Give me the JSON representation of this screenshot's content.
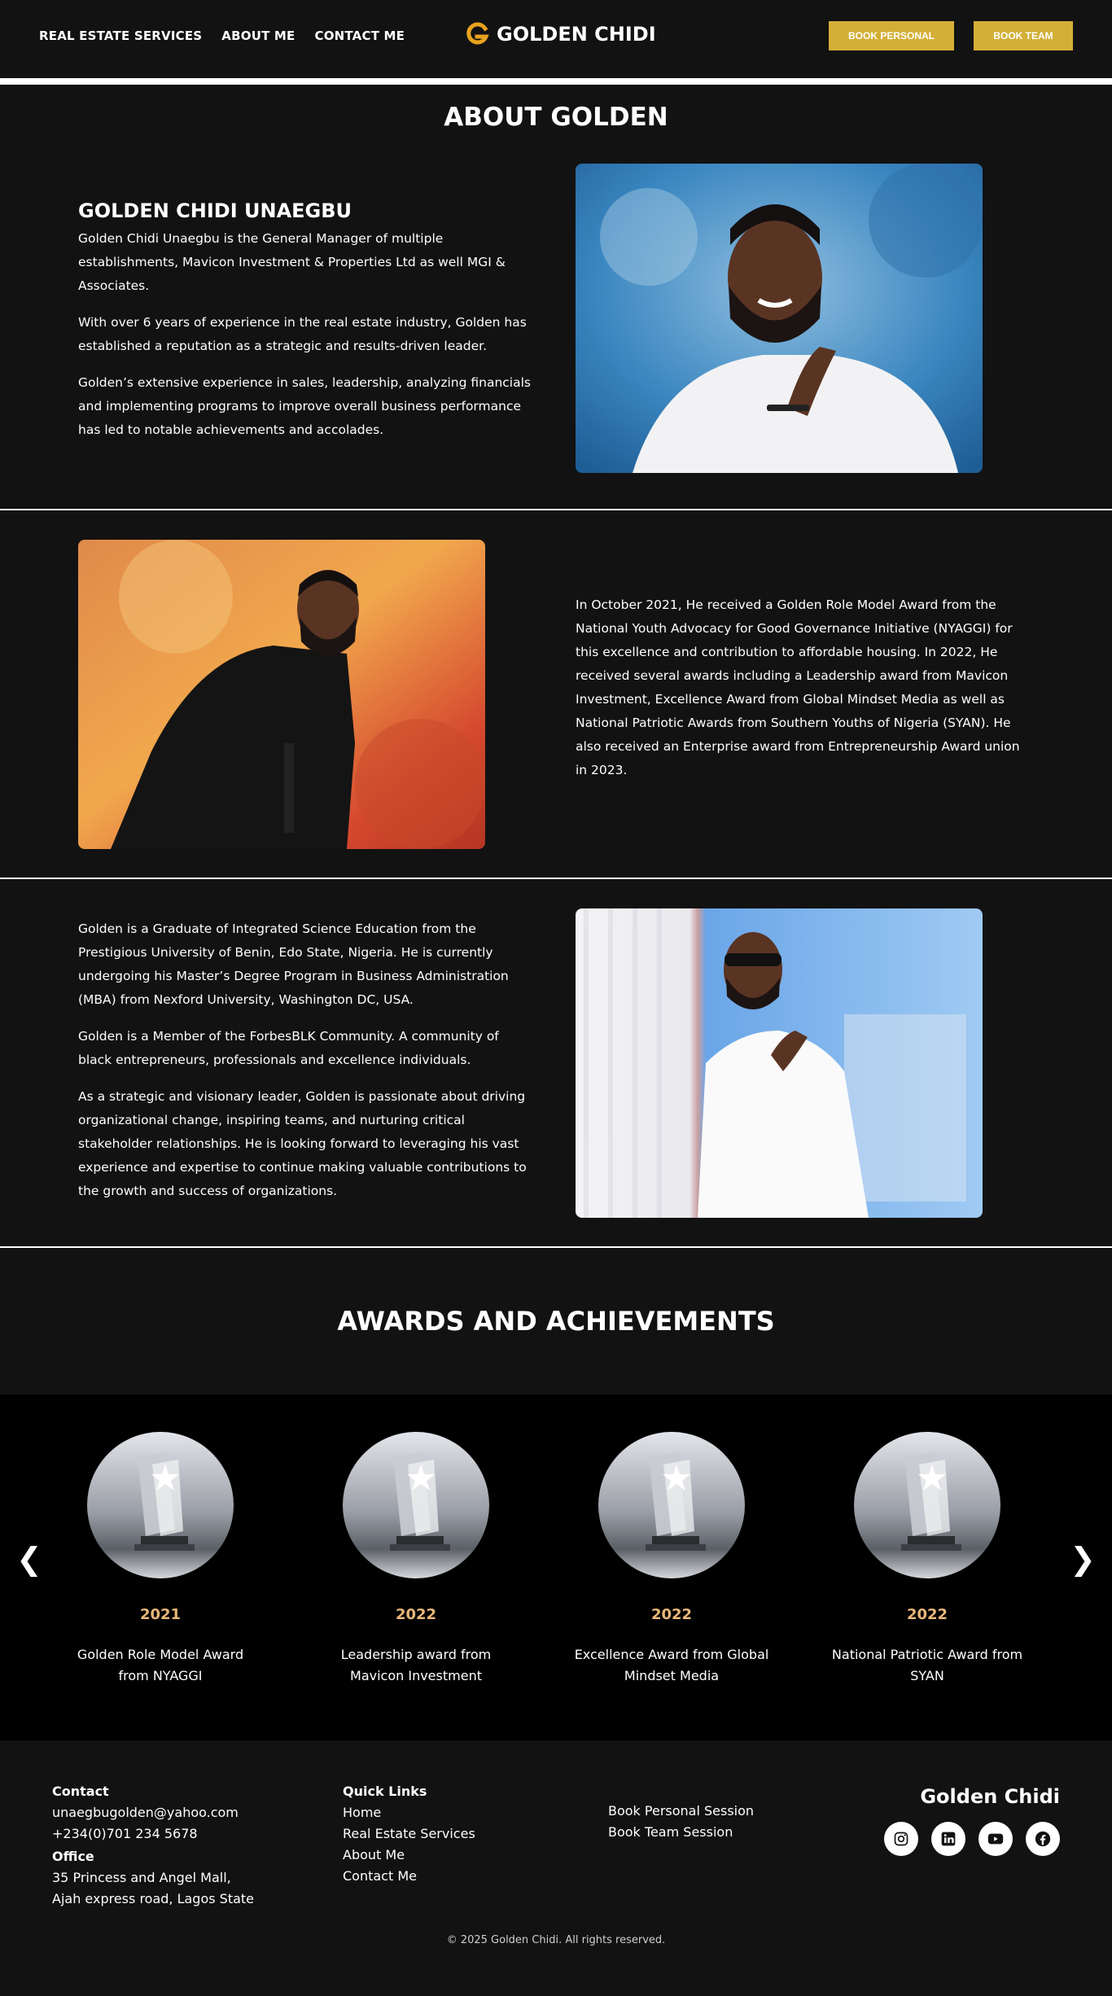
{
  "nav": {
    "links": [
      "REAL ESTATE SERVICES",
      "ABOUT ME",
      "CONTACT ME"
    ],
    "logo_text": "GOLDEN CHIDI",
    "book_personal": "BOOK PERSONAL",
    "book_team": "BOOK TEAM"
  },
  "about": {
    "title": "ABOUT GOLDEN",
    "name": "GOLDEN CHIDI UNAEGBU",
    "block1": [
      "Golden Chidi Unaegbu is the General Manager of multiple establishments, Mavicon Investment & Properties Ltd as well MGI & Associates.",
      "With over 6 years of experience in the real estate industry, Golden has established a reputation as a strategic and results-driven leader.",
      "Golden’s extensive experience in sales, leadership, analyzing financials and implementing programs to improve overall business performance has led to notable achievements and accolades."
    ],
    "block2": "In October 2021, He received a Golden Role Model Award from the National Youth Advocacy for Good Governance Initiative (NYAGGI) for this excellence and contribution to affordable housing. In 2022, He received several awards including a Leadership award from Mavicon Investment, Excellence Award from Global Mindset Media as well as National Patriotic Awards from Southern Youths of Nigeria (SYAN). He also received an Enterprise award from Entrepreneurship Award union in 2023.",
    "block3": [
      "Golden is a Graduate of Integrated Science Education from the Prestigious University of Benin, Edo State, Nigeria. He is currently undergoing his Master’s Degree Program in Business Administration (MBA) from Nexford University, Washington DC, USA.",
      "Golden is a Member of the ForbesBLK Community. A community of black entrepreneurs, professionals and excellence individuals.",
      "As a strategic and visionary leader, Golden is passionate about driving organizational change, inspiring teams, and nurturing critical stakeholder relationships. He is looking forward to leveraging his vast experience and expertise to continue making valuable contributions to the growth and success of organizations."
    ]
  },
  "awards": {
    "title": "AWARDS AND ACHIEVEMENTS",
    "prev": "❮",
    "next": "❯",
    "items": [
      {
        "year": "2021",
        "name": "Golden Role Model Award from NYAGGI"
      },
      {
        "year": "2022",
        "name": "Leadership award from Mavicon Investment"
      },
      {
        "year": "2022",
        "name": "Excellence Award from Global Mindset Media"
      },
      {
        "year": "2022",
        "name": "National Patriotic Award from SYAN"
      }
    ]
  },
  "footer": {
    "contact_heading": "Contact",
    "email": "unaegbugolden@yahoo.com",
    "phone": "+234(0)701 234 5678",
    "office_heading": "Office",
    "address_line1": "35 Princess and Angel Mall,",
    "address_line2": "Ajah express road, Lagos State",
    "quick_links_heading": "Quick Links",
    "quick_links": [
      "Home",
      "Real Estate Services",
      "About Me",
      "Contact Me"
    ],
    "book_links": [
      "Book Personal Session",
      "Book Team Session"
    ],
    "brand": "Golden Chidi",
    "socials": [
      "instagram-icon",
      "linkedin-icon",
      "youtube-icon",
      "facebook-icon"
    ],
    "copyright": "© 2025 Golden Chidi. All rights reserved."
  },
  "colors": {
    "background": "#121212",
    "gold": "#d4af37",
    "award_year": "#e9b77a",
    "strip": "#000000"
  }
}
